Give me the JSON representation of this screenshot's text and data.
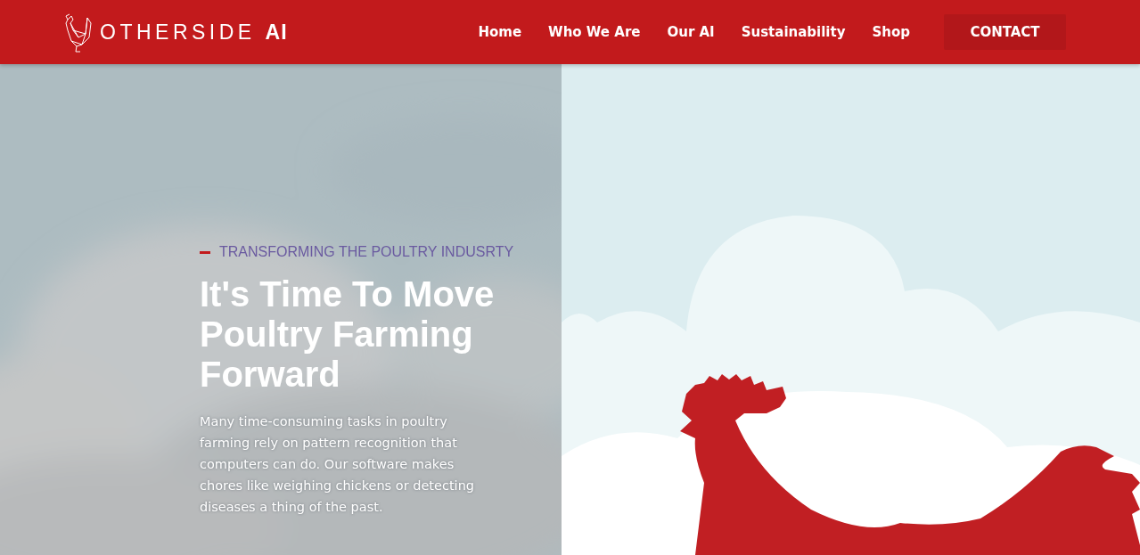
{
  "header": {
    "logo_text": "OTHERSIDE",
    "logo_suffix": "AI",
    "nav": [
      {
        "label": "Home"
      },
      {
        "label": "Who We Are"
      },
      {
        "label": "Our AI"
      },
      {
        "label": "Sustainability"
      },
      {
        "label": "Shop"
      }
    ],
    "cta": "CONTACT"
  },
  "hero": {
    "eyebrow": "TRANSFORMING THE POULTRY INDUSRTY",
    "title": "It's Time To Move Poultry Farming Forward",
    "body": "Many time-consuming tasks in poultry farming rely on pattern recognition that computers can do. Our software makes chores like weighing chickens or detecting diseases a thing of the past."
  }
}
